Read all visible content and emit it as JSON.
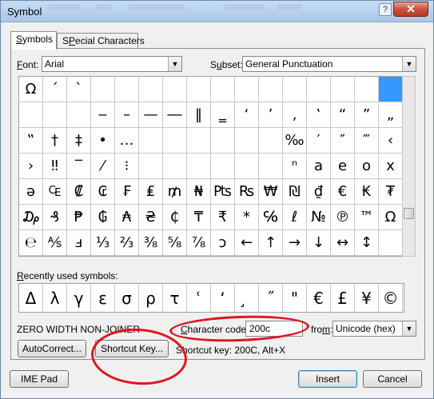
{
  "window": {
    "title": "Symbol",
    "close_glyph": "✕",
    "help_glyph": "?"
  },
  "tabs": [
    {
      "label": "Symbols",
      "mnemonic": "S",
      "rest": "ymbols"
    },
    {
      "label": "Special Characters",
      "mnemonic": "P",
      "prefix": "S",
      "rest": "ecial Characters"
    }
  ],
  "font": {
    "label_mn": "F",
    "label_rest": "ont:",
    "value": "Arial"
  },
  "subset": {
    "label_pre": "S",
    "label_mn": "u",
    "label_rest": "bset:",
    "value": "General Punctuation"
  },
  "grid": {
    "rows": [
      [
        "Ω",
        "ˊ",
        "ˋ",
        "",
        "",
        "",
        "",
        "",
        "",
        "",
        "",
        "",
        "",
        "",
        "",
        ""
      ],
      [
        "",
        "",
        "",
        "‒",
        "–",
        "—",
        "―",
        "‖",
        "‗",
        "‘",
        "’",
        "‚",
        "‛",
        "“",
        "”",
        "„"
      ],
      [
        "‟",
        "†",
        "‡",
        "•",
        "…",
        "",
        "",
        "",
        "",
        "",
        "",
        "‰",
        "′",
        "″",
        "‴",
        "‹"
      ],
      [
        "›",
        "‼",
        "‾",
        "⁄",
        "⁝",
        "",
        "",
        "",
        "",
        "",
        "",
        "ⁿ",
        "a",
        "e",
        "o",
        "x"
      ],
      [
        "ə",
        "₠",
        "₡",
        "₢",
        "₣",
        "₤",
        "₥",
        "₦",
        "₧",
        "₨",
        "₩",
        "₪",
        "₫",
        "€",
        "₭",
        "₮"
      ],
      [
        "₯",
        "₰",
        "₱",
        "₲",
        "₳",
        "₴",
        "₵",
        "₸",
        "₹",
        "*",
        "℅",
        "ℓ",
        "№",
        "℗",
        "™",
        "Ω"
      ],
      [
        "℮",
        "⅍",
        "ⅎ",
        "⅓",
        "⅔",
        "⅜",
        "⅝",
        "⅞",
        "ↄ",
        "←",
        "↑",
        "→",
        "↓",
        "↔",
        "↕",
        ""
      ]
    ],
    "selected": {
      "row": 0,
      "col": 15
    }
  },
  "recent": {
    "label": "Recently used symbols:",
    "label_mn": "R",
    "label_rest": "ecently used symbols:",
    "items": [
      "Δ",
      "λ",
      "γ",
      "ε",
      "σ",
      "ρ",
      "τ",
      "ʿ",
      "ʻ",
      "̧",
      "˝",
      "\"",
      "€",
      "£",
      "¥",
      "©"
    ]
  },
  "char_name": "ZERO WIDTH NON-JOINER",
  "char_code": {
    "label_mn": "C",
    "label_rest": "haracter code:",
    "value": "200c"
  },
  "from": {
    "label_pre": "fro",
    "label_mn": "m",
    "label_rest": ":",
    "value": "Unicode (hex)"
  },
  "autocorrect_button": "AutoCorrect...",
  "shortcut_key_button": "Shortcut Key...",
  "shortcut_text": "Shortcut key: 200C, Alt+X",
  "ime_pad_button": "IME Pad",
  "insert_button": "Insert",
  "cancel_button": "Cancel",
  "colors": {
    "selection": "#3399ff",
    "annotation": "#e0151f"
  }
}
